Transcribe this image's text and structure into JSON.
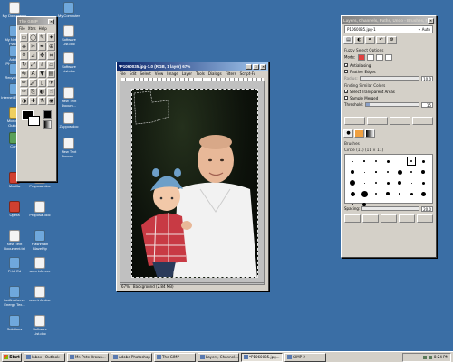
{
  "desktop": {
    "background": "#3a6ea5",
    "icons": [
      {
        "label": "My Documents",
        "kind": "doc"
      },
      {
        "label": "My Computer",
        "kind": "app"
      },
      {
        "label": "My Network Places",
        "kind": "app"
      },
      {
        "label": "Adobe Photoshop",
        "kind": "app"
      },
      {
        "label": "Recycle Bin",
        "kind": "app"
      },
      {
        "label": "Software List.doc",
        "kind": "doc"
      },
      {
        "label": "Internet Explorer",
        "kind": "app"
      },
      {
        "label": "Software List.doc",
        "kind": "doc"
      },
      {
        "label": "Microsoft Outlook",
        "kind": "yel"
      },
      {
        "label": "New Text Docum...",
        "kind": "doc"
      },
      {
        "label": "Corel",
        "kind": "grn"
      },
      {
        "label": "Zappos.doc",
        "kind": "doc"
      },
      {
        "label": "New Text Docum...",
        "kind": "doc"
      },
      {
        "label": "Mozilla",
        "kind": "red"
      },
      {
        "label": "Proposal.doc",
        "kind": "doc"
      },
      {
        "label": "Opera",
        "kind": "red"
      },
      {
        "label": "Proposal.doc",
        "kind": "doc"
      },
      {
        "label": "New Text Document.txt",
        "kind": "doc"
      },
      {
        "label": "Flashmain BlazeFtp",
        "kind": "app"
      },
      {
        "label": "Print Ed",
        "kind": "app"
      },
      {
        "label": "areo info.xxx",
        "kind": "doc"
      },
      {
        "label": "toolfinishers - Energy Tex...",
        "kind": "app"
      },
      {
        "label": "areo info.doc",
        "kind": "doc"
      },
      {
        "label": "Solutions",
        "kind": "app"
      },
      {
        "label": "Software List.doc",
        "kind": "doc"
      }
    ]
  },
  "toolbox": {
    "title": "The GIMP",
    "menu": [
      "File",
      "Xtns",
      "Help"
    ],
    "tools": [
      "select-rect",
      "select-ellipse",
      "lasso",
      "fuzzy-select",
      "select-color",
      "scissors",
      "paths",
      "color-picker",
      "zoom",
      "measure",
      "move",
      "crop",
      "rotate",
      "scale",
      "shear",
      "perspective",
      "flip",
      "text",
      "bucket-fill",
      "blend",
      "pencil",
      "paintbrush",
      "eraser",
      "airbrush",
      "ink",
      "clone",
      "convolve",
      "smudge",
      "dodge",
      "heal",
      "picker",
      "eye"
    ],
    "tool_glyphs": [
      "▭",
      "◯",
      "✎",
      "✦",
      "◈",
      "✂",
      "✒",
      "⊕",
      "⚲",
      "⊿",
      "✥",
      "⌗",
      "↻",
      "⤢",
      "⫽",
      "▱",
      "⇋",
      "A",
      "▼",
      "▤",
      "✏",
      "🖌",
      "▯",
      "✈",
      "✑",
      "⎘",
      "◐",
      "☝",
      "◑",
      "✚",
      "⚗",
      "◉"
    ],
    "fg_color": "#000000",
    "bg_color": "#ffffff"
  },
  "image_window": {
    "title": "*P1060035.jpg-1.0 (RGB, 1 layer) 67%",
    "menu": [
      "File",
      "Edit",
      "Select",
      "View",
      "Image",
      "Layer",
      "Tools",
      "Dialogs",
      "Filters",
      "Script-Fu"
    ],
    "status": "Background (2.84 MB)",
    "zoom": "67%"
  },
  "dock": {
    "title": "Layers, Channels, Paths, Undo - Brushes, Patterns, Gradients",
    "image_selector": "P1060035.jpg-1",
    "auto_label": "Auto",
    "tool_options_title": "Fuzzy Select Options",
    "mode_label": "Mode:",
    "antialiasing_label": "Antialiasing",
    "feather_label": "Feather Edges",
    "radius_label": "Radius:",
    "radius_value": "10.0",
    "finding_label": "Finding Similar Colors",
    "select_transparent_label": "Select Transparent Areas",
    "sample_merged_label": "Sample Merged",
    "threshold_label": "Threshold:",
    "threshold_value": "15",
    "threshold_fraction": 0.06,
    "brushes_title": "Brushes",
    "brush_name": "Circle (11) (11 × 11)",
    "spacing_label": "Spacing:",
    "spacing_value": "20.0"
  },
  "taskbar": {
    "start_label": "Start",
    "items": [
      {
        "label": "Inbox - Outlook",
        "pressed": false
      },
      {
        "label": "Mr. Pete Brown...",
        "pressed": false
      },
      {
        "label": "Adobe Photoshop",
        "pressed": false
      },
      {
        "label": "The GIMP",
        "pressed": false
      },
      {
        "label": "Layers, Channel...",
        "pressed": false
      },
      {
        "label": "*P1060035.jpg...",
        "pressed": true
      },
      {
        "label": "GIMP 2",
        "pressed": false
      }
    ],
    "clock": "8:24 PM"
  }
}
